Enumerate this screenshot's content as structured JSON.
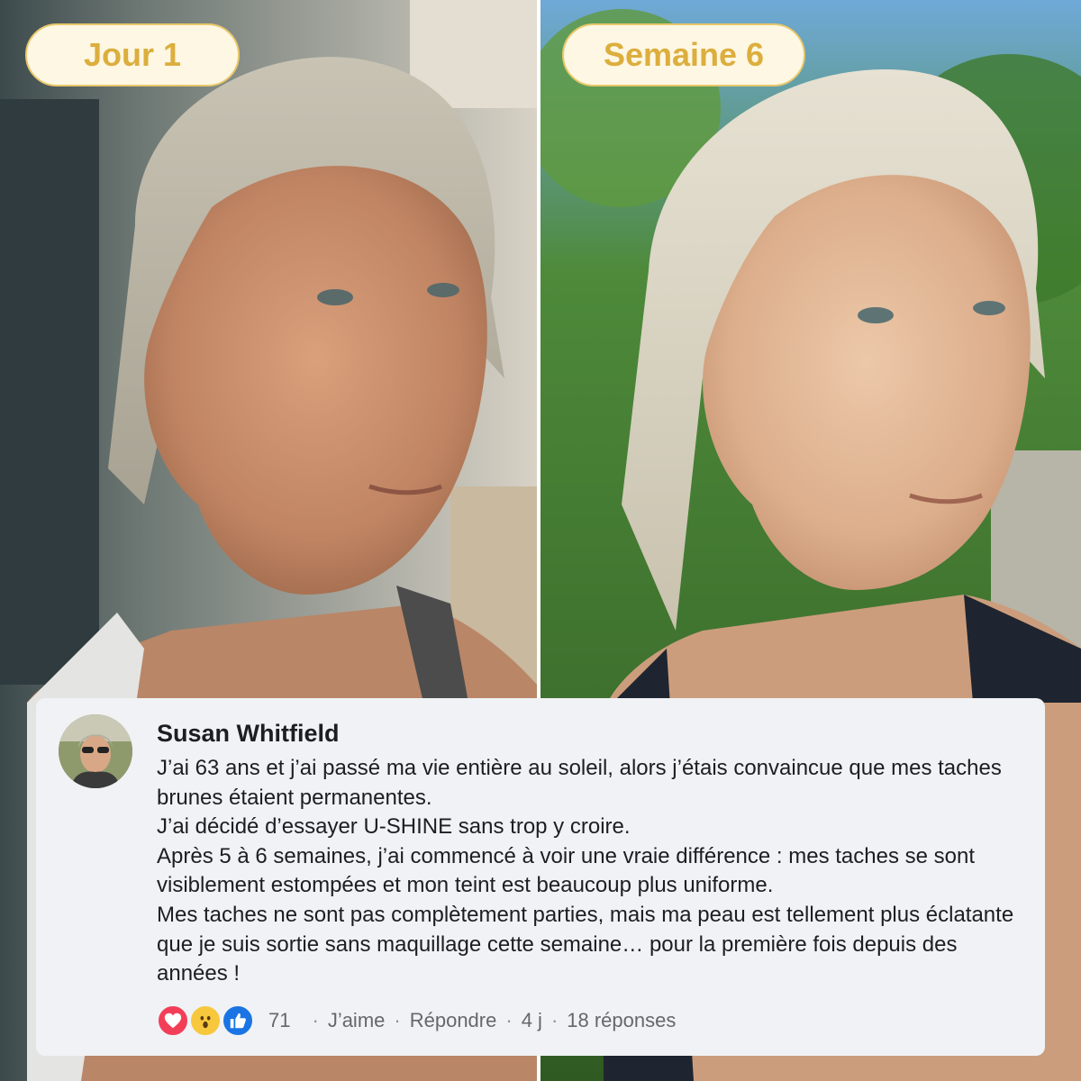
{
  "labels": {
    "before": "Jour 1",
    "after": "Semaine 6"
  },
  "comment": {
    "author": "Susan Whitfield",
    "lines": [
      "J’ai 63 ans et j’ai passé ma vie entière au soleil, alors j’étais convaincue que mes taches brunes étaient permanentes.",
      "J’ai décidé d’essayer U-SHINE sans trop y croire.",
      "Après 5 à 6 semaines, j’ai commencé à voir une vraie différence : mes taches se sont visiblement estompées et mon teint est beaucoup plus uniforme.",
      "Mes taches ne sont pas complètement parties, mais ma peau est tellement plus éclatante que je suis sortie sans maquillage cette semaine… pour la première fois depuis des années !"
    ],
    "reactions": [
      "heart-icon",
      "wow-icon",
      "like-icon"
    ],
    "reaction_count": "71",
    "like_label": "J’aime",
    "reply_label": "Répondre",
    "time": "4 j",
    "replies": "18 réponses",
    "separator": "·"
  },
  "colors": {
    "pill_bg": "#fdf7e3",
    "pill_text": "#dcae3d",
    "card_bg": "#f0f2f5",
    "heart": "#f33e58",
    "like": "#1b74e4"
  }
}
